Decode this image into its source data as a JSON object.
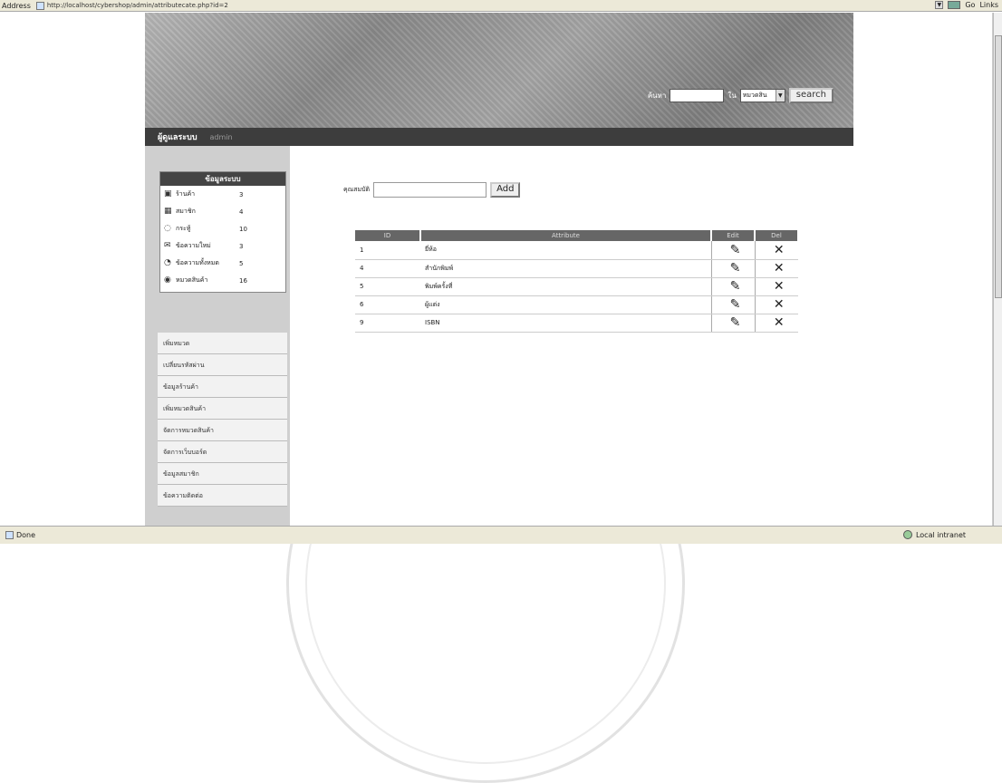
{
  "browser": {
    "address_label": "Address",
    "url": "http://localhost/cybershop/admin/attributecate.php?id=2",
    "go_label": "Go",
    "links_label": "Links",
    "status_text": "Done",
    "zone_text": "Local intranet"
  },
  "header": {
    "search_label": "ค้นหา",
    "search_value": "",
    "in_label": "ใน",
    "search_select": "หมวดสิน",
    "search_button": "search"
  },
  "nav": {
    "title": "ผู้ดูแลระบบ",
    "user": "admin"
  },
  "stats": {
    "heading": "ข้อมูลระบบ",
    "items": [
      {
        "label": "ร้านค้า",
        "count": "3",
        "icon": "shop-icon"
      },
      {
        "label": "สมาชิก",
        "count": "4",
        "icon": "members-icon"
      },
      {
        "label": "กระทู้",
        "count": "10",
        "icon": "topics-icon"
      },
      {
        "label": "ข้อความใหม่",
        "count": "3",
        "icon": "new-message-icon"
      },
      {
        "label": "ข้อความทั้งหมด",
        "count": "5",
        "icon": "all-messages-icon"
      },
      {
        "label": "หมวดสินค้า",
        "count": "16",
        "icon": "category-icon"
      }
    ]
  },
  "menu": {
    "items": [
      "เพิ่มหมวด",
      "เปลี่ยนรหัสผ่าน",
      "ข้อมูลร้านค้า",
      "เพิ่มหมวดสินค้า",
      "จัดการหมวดสินค้า",
      "จัดการเว็บบอร์ด",
      "ข้อมูลสมาชิก",
      "ข้อความติดต่อ"
    ]
  },
  "form": {
    "add_label": "คุณสมบัติ",
    "input_value": "",
    "add_button": "Add"
  },
  "table": {
    "headers": [
      "ID",
      "Attribute",
      "Edit",
      "Del"
    ],
    "rows": [
      {
        "id": "1",
        "name": "ยี่ห้อ"
      },
      {
        "id": "4",
        "name": "สำนักพิมพ์"
      },
      {
        "id": "5",
        "name": "พิมพ์ครั้งที่"
      },
      {
        "id": "6",
        "name": "ผู้แต่ง"
      },
      {
        "id": "9",
        "name": "ISBN"
      }
    ]
  }
}
